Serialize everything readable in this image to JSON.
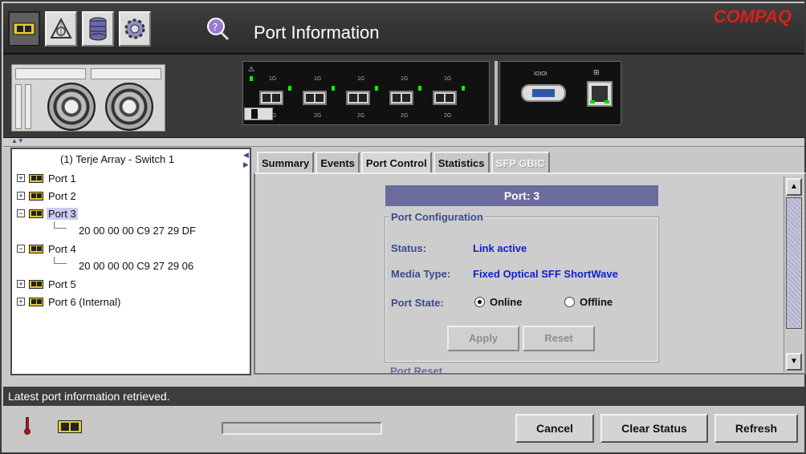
{
  "window": {
    "title": "Port Information",
    "brand": "COMPAQ"
  },
  "toolbar": {
    "icons": [
      "switch-icon",
      "fabric-icon",
      "database-icon",
      "settings-icon",
      "help-icon"
    ]
  },
  "switch_view": {
    "port_speed_top": "1G",
    "port_speed_bottom": "2G",
    "port_count": 5,
    "serial_label": "IOIOI"
  },
  "tree": {
    "root": "(1) Terje Array - Switch 1",
    "items": [
      {
        "label": "Port 1",
        "expanded": false
      },
      {
        "label": "Port 2",
        "expanded": false
      },
      {
        "label": "Port 3",
        "expanded": true,
        "selected": true,
        "child": "20 00 00 00 C9 27 29 DF"
      },
      {
        "label": "Port 4",
        "expanded": true,
        "child": "20 00 00 00 C9 27 29 06"
      },
      {
        "label": "Port 5",
        "expanded": false
      },
      {
        "label": "Port 6 (Internal)",
        "expanded": false
      }
    ]
  },
  "tabs": [
    {
      "label": "Summary"
    },
    {
      "label": "Events"
    },
    {
      "label": "Port Control",
      "active": true
    },
    {
      "label": "Statistics"
    },
    {
      "label": "SFP GBIC",
      "disabled": true
    }
  ],
  "port_panel": {
    "header": "Port: 3",
    "group_title": "Port Configuration",
    "status_label": "Status:",
    "status_value": "Link active",
    "media_label": "Media Type:",
    "media_value": "Fixed Optical SFF ShortWave",
    "state_label": "Port State:",
    "online_label": "Online",
    "offline_label": "Offline",
    "selected_state": "Online",
    "apply_label": "Apply",
    "reset_label": "Reset",
    "next_group_title": "Port Reset"
  },
  "status_message": "Latest port information retrieved.",
  "buttons": {
    "cancel": "Cancel",
    "clear_status": "Clear Status",
    "refresh": "Refresh"
  },
  "colors": {
    "header_bg": "#2f2f2f",
    "brand": "#d9201f",
    "panel_header": "#6b6b9e",
    "label": "#3b4b8b",
    "value": "#0b1fd0"
  }
}
